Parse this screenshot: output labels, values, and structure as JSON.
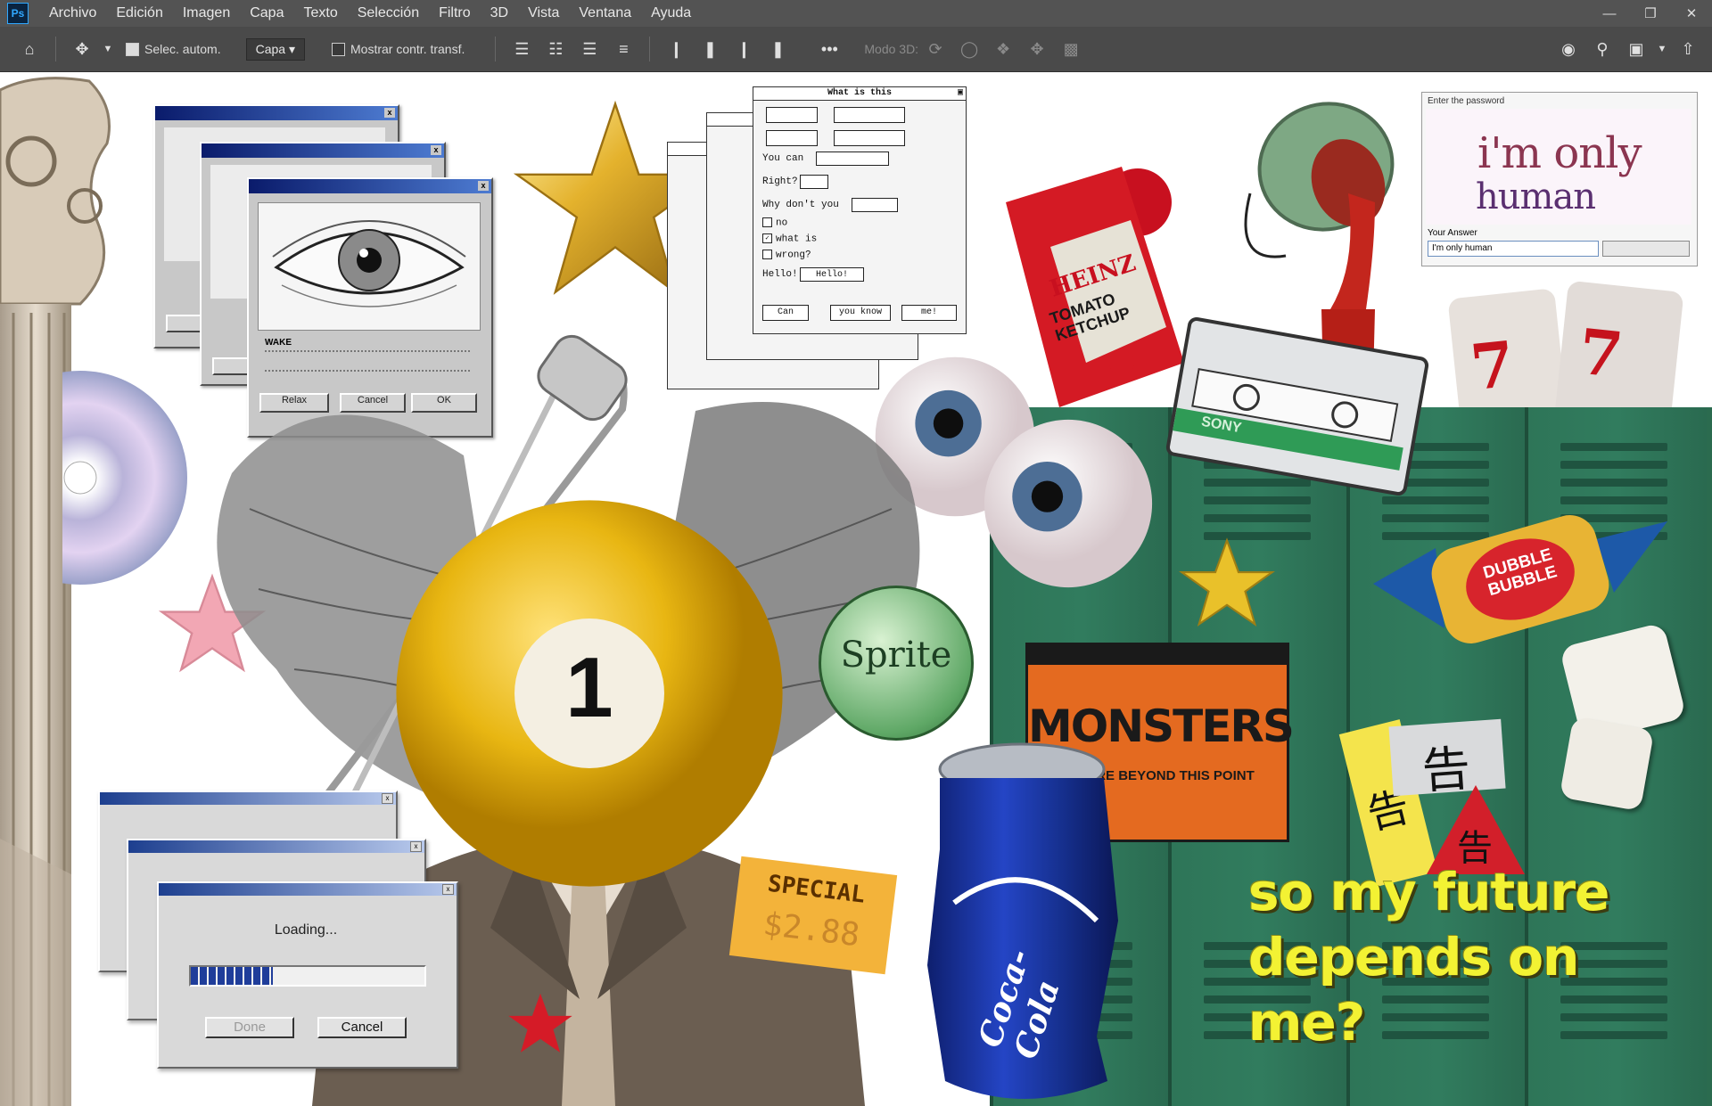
{
  "app": {
    "name": "Photoshop",
    "logo": "Ps",
    "menu": [
      "Archivo",
      "Edición",
      "Imagen",
      "Capa",
      "Texto",
      "Selección",
      "Filtro",
      "3D",
      "Vista",
      "Ventana",
      "Ayuda"
    ],
    "window_controls": [
      "minimize-icon",
      "restore-icon",
      "close-icon"
    ]
  },
  "options_bar": {
    "auto_select_label": "Selec. autom.",
    "auto_select_checked": true,
    "layer_select": "Capa",
    "transform_controls_label": "Mostrar contr. transf.",
    "transform_checked": false,
    "mode_3d_label": "Modo 3D:",
    "more_label": "•••"
  },
  "canvas": {
    "eye_dialog": {
      "btn_1": "Relax",
      "btn_2": "Cancel",
      "btn_3": "OK",
      "label": "WAKE"
    },
    "question_dialog": {
      "title": "What is this",
      "rows": [
        "You can",
        "Right?",
        "Why don't you",
        "Hello!"
      ],
      "check_items": [
        "no",
        "what is",
        "wrong?"
      ],
      "buttons": [
        "Can",
        "you know",
        "me!"
      ],
      "field_value": "Hello!"
    },
    "human_panel": {
      "header": "Enter the password",
      "big_text_1": "i'm only",
      "big_text_2": "human",
      "answer_label": "Your Answer",
      "answer_value": "I'm only human"
    },
    "loading_dialog": {
      "loading_label": "Loading...",
      "ok_label": "Done",
      "cancel_label": "Cancel",
      "progress": 0.35
    },
    "sticker_texts": {
      "heinz": "HEINZ",
      "ketchup": "TOMATO KETCHUP",
      "sprite": "Sprite",
      "special": "SPECIAL",
      "price": "$2.88",
      "monsters": "MONSTERS",
      "monsters_sub": "FUTURE BEYOND THIS POINT",
      "dubble": "DUBBLE BUBBLE",
      "cassette_brand": "SONY",
      "ball_number": "1",
      "kanji": "告",
      "coke": "Coca-Cola",
      "playing_card": "7"
    },
    "headline": [
      "so my future",
      "depends on",
      "me?"
    ]
  },
  "colors": {
    "menubar": "#535353",
    "optbar": "#4a4a4a",
    "locker_green": "#2e7558",
    "headline_yellow": "#f3f233",
    "win98_blue": "#0a1b6b"
  }
}
